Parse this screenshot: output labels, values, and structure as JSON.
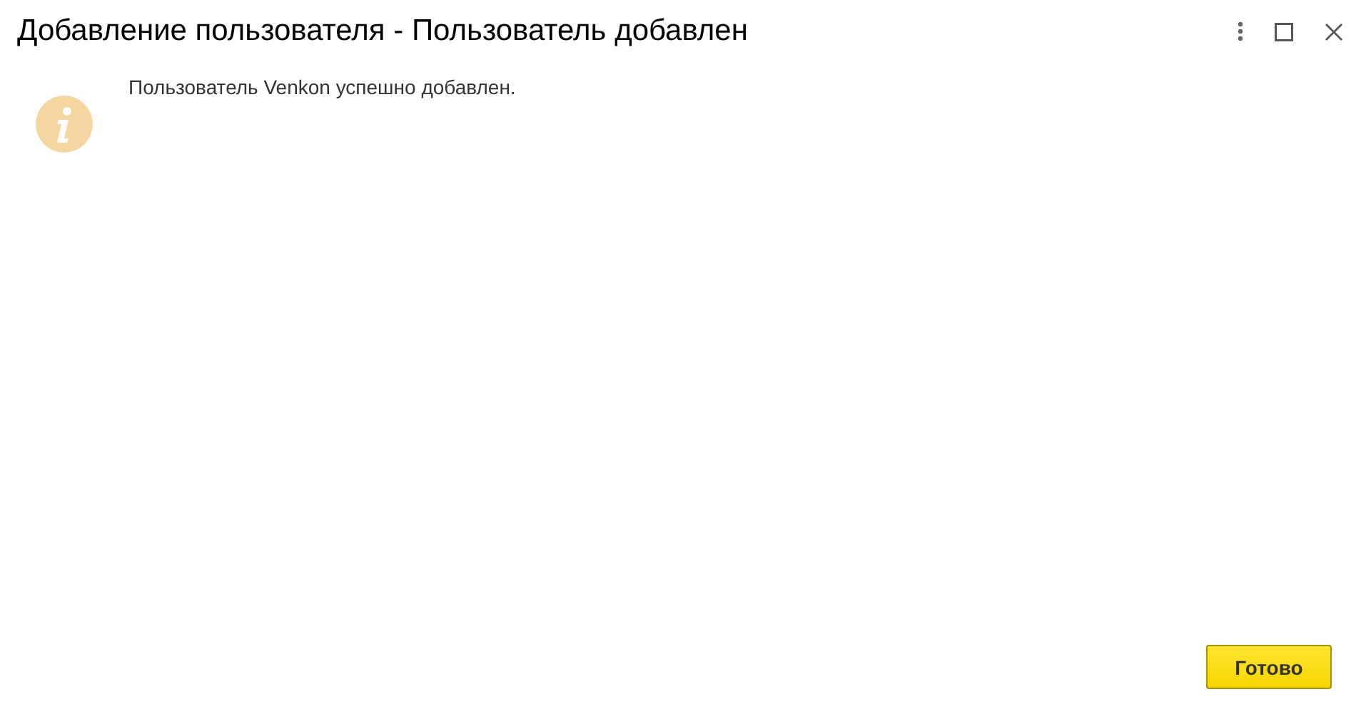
{
  "window": {
    "title": "Добавление пользователя - Пользователь добавлен"
  },
  "message": {
    "text": "Пользователь Venkon успешно добавлен."
  },
  "buttons": [
    {
      "label": "Готово",
      "kind": "primary"
    }
  ]
}
